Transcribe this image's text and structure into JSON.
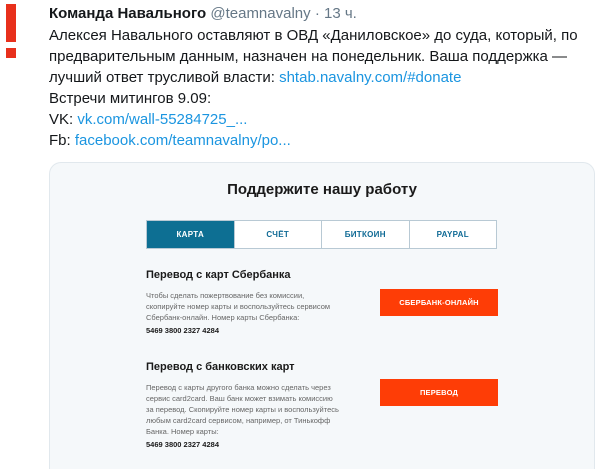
{
  "tweet": {
    "author_name": "Команда Навального",
    "handle": "@teamnavalny",
    "separator": "·",
    "time": "13 ч.",
    "line1": "Алексея Навального оставляют в ОВД «Даниловское» до суда, который, по",
    "line2": "предварительным данным, назначен на понедельник. Ваша поддержка —",
    "line3_text": "лучший ответ трусливой власти: ",
    "line3_link": "shtab.navalny.com/#donate",
    "line4": "Встречи митингов 9.09:",
    "line5_label": "VK: ",
    "line5_link": "vk.com/wall-55284725_...",
    "line6_label": "Fb: ",
    "line6_link": "facebook.com/teamnavalny/po..."
  },
  "card": {
    "title": "Поддержите нашу работу",
    "tabs": [
      "КАРТА",
      "СЧЁТ",
      "БИТКОИН",
      "PAYPAL"
    ],
    "sections": [
      {
        "title": "Перевод с карт Сбербанка",
        "lines": [
          "Чтобы сделать пожертвование без комиссии,",
          "скопируйте номер карты и воспользуйтесь сервисом",
          "Сбербанк-онлайн. Номер карты Сбербанка:"
        ],
        "card_number": "5469 3800 2327 4284",
        "button": "СБЕРБАНК-ОНЛАЙН"
      },
      {
        "title": "Перевод с банковских карт",
        "lines": [
          "Перевод с карты другого банка можно сделать через",
          "сервис card2card. Ваш банк может взимать комиссию",
          "за перевод. Скопируйте номер карты и воспользуйтесь",
          "любым card2card сервисом, например, от Тинькофф",
          "Банка. Номер карты:"
        ],
        "card_number": "5469 3800 2327 4284",
        "button": "ПЕРЕВОД"
      }
    ]
  },
  "colors": {
    "brand_red": "#e8301c",
    "button_orange": "#fe3d06",
    "tab_active": "#0d6f93",
    "link": "#1b95e0"
  }
}
